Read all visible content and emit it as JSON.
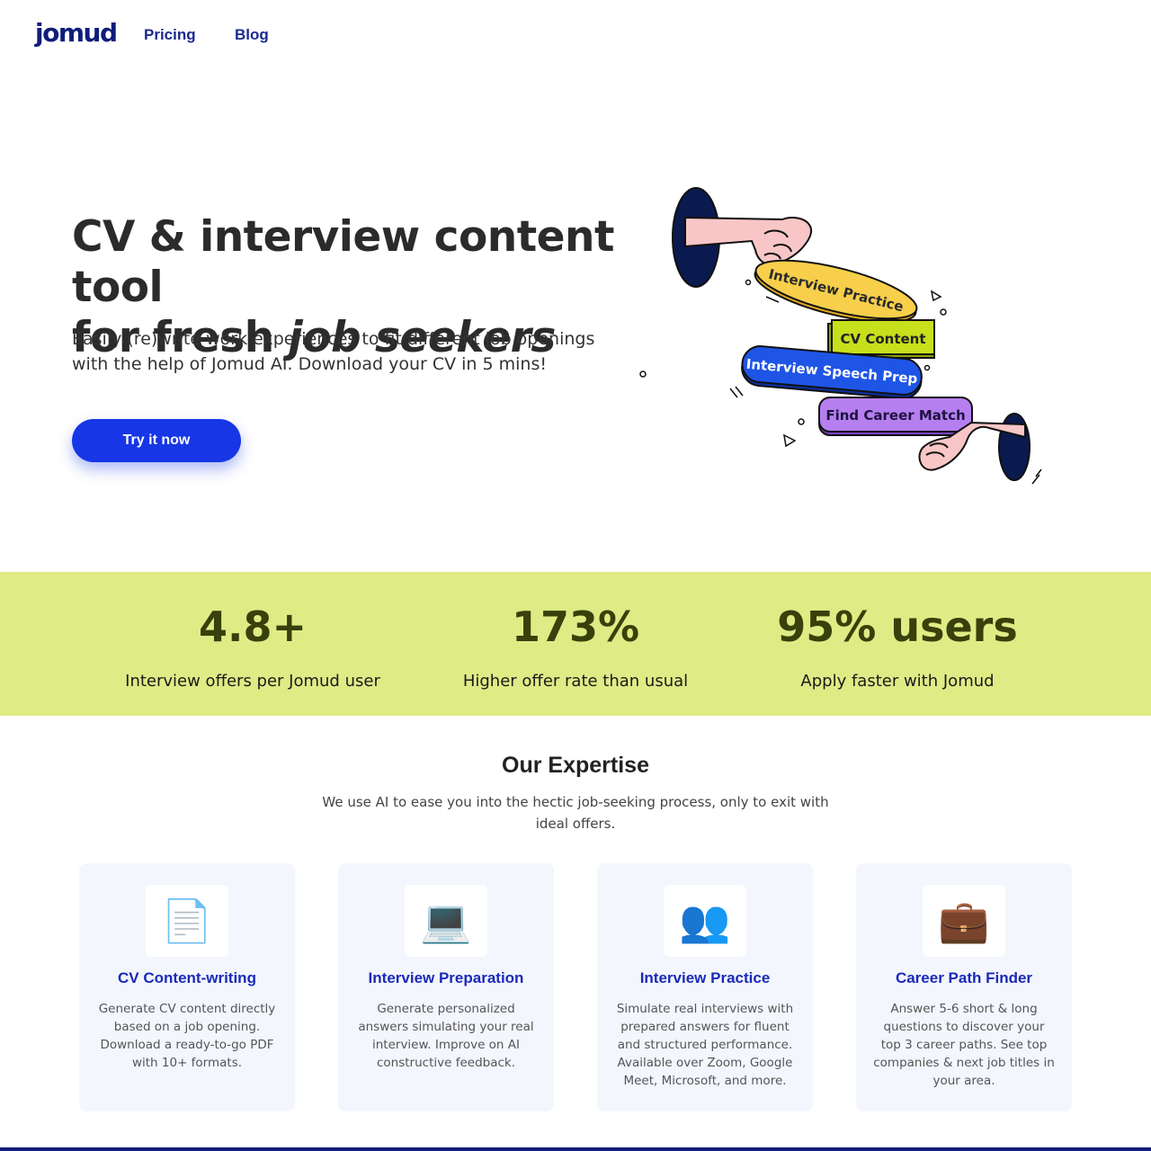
{
  "header": {
    "logo": "jomud",
    "nav": [
      {
        "label": "Pricing"
      },
      {
        "label": "Blog"
      }
    ]
  },
  "hero": {
    "title_line1": "CV & interview content tool",
    "title_line2_plain": "for fresh ",
    "title_line2_emphasis": "job seekers",
    "subtitle": "Easily (re)write work experiences to fit different job openings with the help of Jomud AI. Download your CV in 5 mins!",
    "cta_label": "Try it now"
  },
  "illustration": {
    "pills": [
      {
        "label": "Interview Practice",
        "color": "#f7cf4a"
      },
      {
        "label": "CV Content",
        "color": "#c6e01b"
      },
      {
        "label": "Interview Speech Prep",
        "color": "#1f55e6"
      },
      {
        "label": "Find Career Match",
        "color": "#b57ff0"
      }
    ]
  },
  "stats": [
    {
      "value": "4.8+",
      "label": "Interview offers per Jomud user"
    },
    {
      "value": "173%",
      "label": "Higher offer rate than usual"
    },
    {
      "value": "95% users",
      "label": "Apply faster with Jomud"
    }
  ],
  "expertise": {
    "title": "Our Expertise",
    "subtitle": "We use AI to ease you into the hectic job-seeking process, only to exit with ideal offers.",
    "cards": [
      {
        "icon": "📄",
        "icon_name": "document-icon",
        "title": "CV Content-writing",
        "desc": "Generate CV content directly based on a job opening. Download a ready-to-go PDF with 10+ formats."
      },
      {
        "icon": "💻",
        "icon_name": "laptop-icon",
        "title": "Interview Preparation",
        "desc": "Generate personalized answers simulating your real interview. Improve on AI constructive feedback."
      },
      {
        "icon": "👥",
        "icon_name": "people-icon",
        "title": "Interview Practice",
        "desc": "Simulate real interviews with prepared answers for fluent and structured performance. Available over Zoom, Google Meet, Microsoft, and more."
      },
      {
        "icon": "💼",
        "icon_name": "briefcase-icon",
        "title": "Career Path Finder",
        "desc": "Answer 5-6 short & long questions to discover your top 3 career paths. See top companies & next job titles in your area."
      }
    ]
  },
  "colors": {
    "brand": "#0f1e7a",
    "cta": "#1736e6",
    "stats_band": "#dfeb85",
    "card_bg": "#f3f6fd"
  }
}
